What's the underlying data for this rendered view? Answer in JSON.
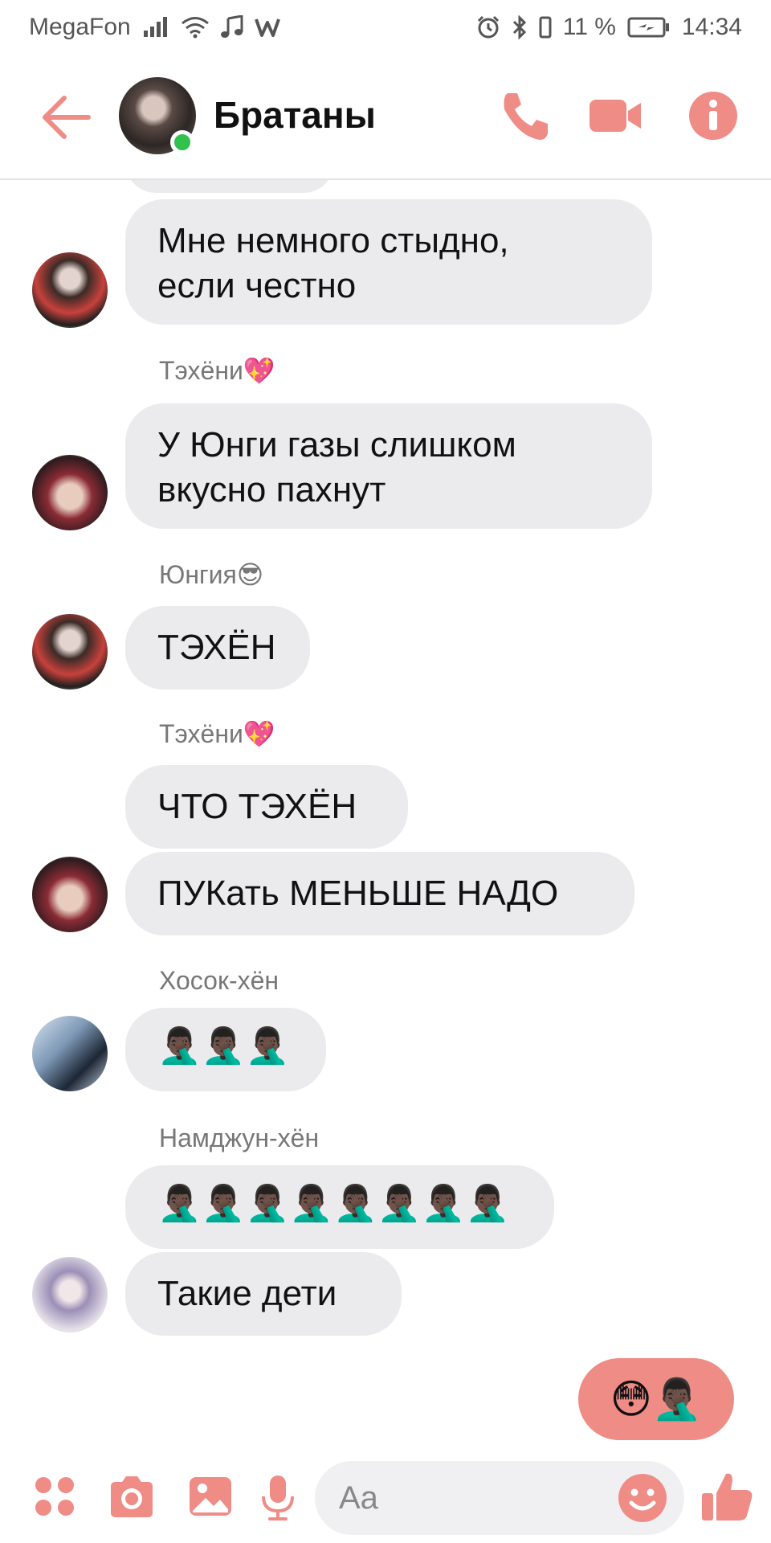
{
  "status_bar": {
    "carrier": "MegaFon",
    "battery": "11 %",
    "time": "14:34"
  },
  "header": {
    "title": "Братаны"
  },
  "messages": [
    {
      "sender": "",
      "text_lines": [
        "Мне немного стыдно,",
        "если честно"
      ],
      "avatar": "yoongi"
    },
    {
      "sender": "Тэхёни💖",
      "text_lines": [
        "У Юнги газы слишком",
        "вкусно пахнут"
      ],
      "avatar": "tae"
    },
    {
      "sender": "Юнгия😎",
      "text_lines": [
        "ТЭХЁН"
      ],
      "avatar": "yoongi"
    },
    {
      "sender": "Тэхёни💖",
      "text_lines": [
        "ЧТО ТЭХЁН"
      ],
      "avatar": ""
    },
    {
      "sender": "",
      "text_lines": [
        "ПУКать МЕНЬШЕ НАДО"
      ],
      "avatar": "tae"
    },
    {
      "sender": "Хосок-хён",
      "text_lines": [
        "🤦🏿‍♂️🤦🏿‍♂️🤦🏿‍♂️"
      ],
      "avatar": "hoseok"
    },
    {
      "sender": "Намджун-хён",
      "text_lines": [
        "🤦🏿‍♂️🤦🏿‍♂️🤦🏿‍♂️🤦🏿‍♂️🤦🏿‍♂️🤦🏿‍♂️🤦🏿‍♂️🤦🏿‍♂️"
      ],
      "avatar": ""
    },
    {
      "sender": "",
      "text_lines": [
        "Такие дети"
      ],
      "avatar": "namjoon"
    }
  ],
  "my_message": "😳🤦🏿‍♂️",
  "composer": {
    "placeholder": "Aa"
  },
  "colors": {
    "accent": "#ef8c86",
    "bubble": "#ebebee",
    "online": "#31c24d"
  }
}
